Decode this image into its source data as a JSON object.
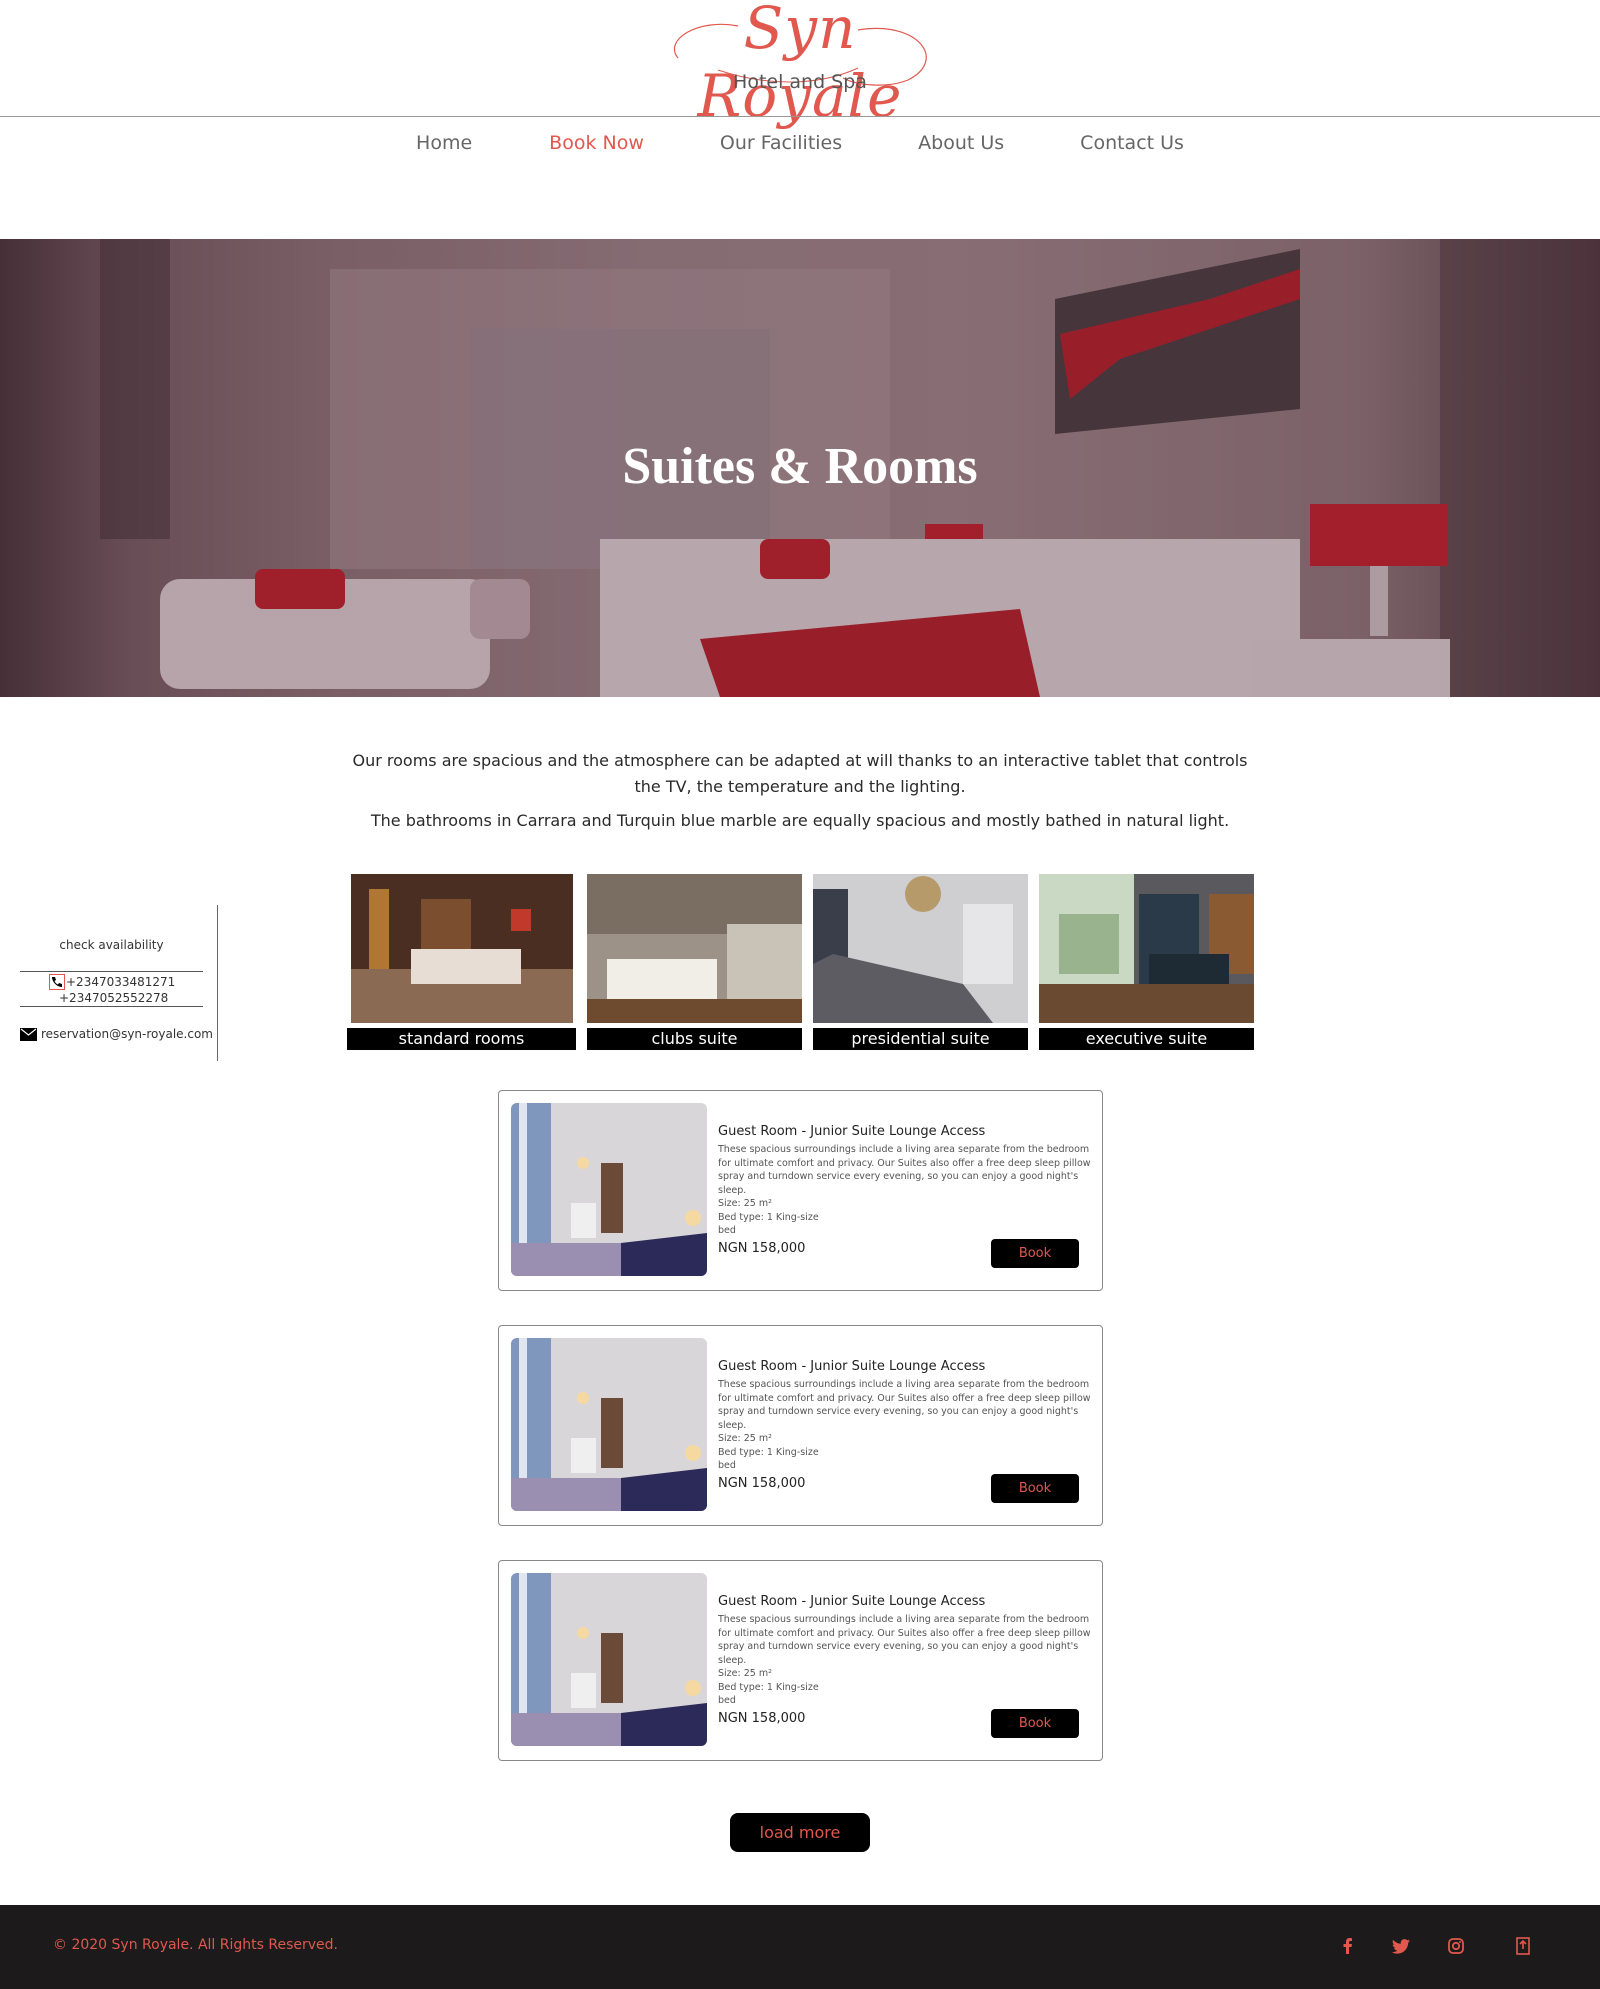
{
  "brand": {
    "logo_script": "Syn Royale",
    "logo_sub": "Hotel and Spa",
    "accent_color": "#e0584e"
  },
  "nav": {
    "items": [
      {
        "label": "Home",
        "active": false
      },
      {
        "label": "Book Now",
        "active": true
      },
      {
        "label": "Our Facilities",
        "active": false
      },
      {
        "label": "About Us",
        "active": false
      },
      {
        "label": "Contact Us",
        "active": false
      }
    ]
  },
  "hero": {
    "title": "Suites & Rooms"
  },
  "intro": {
    "p1": "Our rooms are spacious and the atmosphere can be adapted at will thanks to an interactive tablet that controls the TV, the temperature and the lighting.",
    "p2": "The bathrooms in Carrara and Turquin blue marble are equally spacious and mostly bathed in natural light."
  },
  "side_panel": {
    "title": "check availability",
    "phone1": "+2347033481271",
    "phone2": "+2347052552278",
    "email": "reservation@syn-royale.com",
    "phone_icon": "phone-icon",
    "email_icon": "envelope-icon"
  },
  "categories": [
    {
      "label": "standard rooms"
    },
    {
      "label": "clubs suite"
    },
    {
      "label": "presidential suite"
    },
    {
      "label": "executive suite"
    }
  ],
  "rooms": [
    {
      "title": "Guest Room - Junior Suite Lounge Access",
      "description": "These spacious surroundings include a living area separate from the bedroom for ultimate comfort and privacy. Our Suites also offer a free deep sleep pillow spray and turndown service every evening, so you can enjoy a good night's sleep.",
      "size": "Size: 25 m²",
      "bed_type_1": "Bed type: 1 King-size",
      "bed_type_2": "bed",
      "price": "NGN 158,000",
      "book_label": "Book"
    },
    {
      "title": "Guest Room - Junior Suite Lounge Access",
      "description": "These spacious surroundings include a living area separate from the bedroom for ultimate comfort and privacy. Our Suites also offer a free deep sleep pillow spray and turndown service every evening, so you can enjoy a good night's sleep.",
      "size": "Size: 25 m²",
      "bed_type_1": "Bed type: 1 King-size",
      "bed_type_2": "bed",
      "price": "NGN 158,000",
      "book_label": "Book"
    },
    {
      "title": "Guest Room - Junior Suite Lounge Access",
      "description": "These spacious surroundings include a living area separate from the bedroom for ultimate comfort and privacy. Our Suites also offer a free deep sleep pillow spray and turndown service every evening, so you can enjoy a good night's sleep.",
      "size": "Size: 25 m²",
      "bed_type_1": "Bed type: 1 King-size",
      "bed_type_2": "bed",
      "price": "NGN 158,000",
      "book_label": "Book"
    }
  ],
  "load_more": "load more",
  "footer": {
    "copyright": "© 2020 Syn Royale. All Rights Reserved.",
    "social": [
      "facebook-icon",
      "twitter-icon",
      "instagram-icon",
      "tripadvisor-icon"
    ]
  }
}
